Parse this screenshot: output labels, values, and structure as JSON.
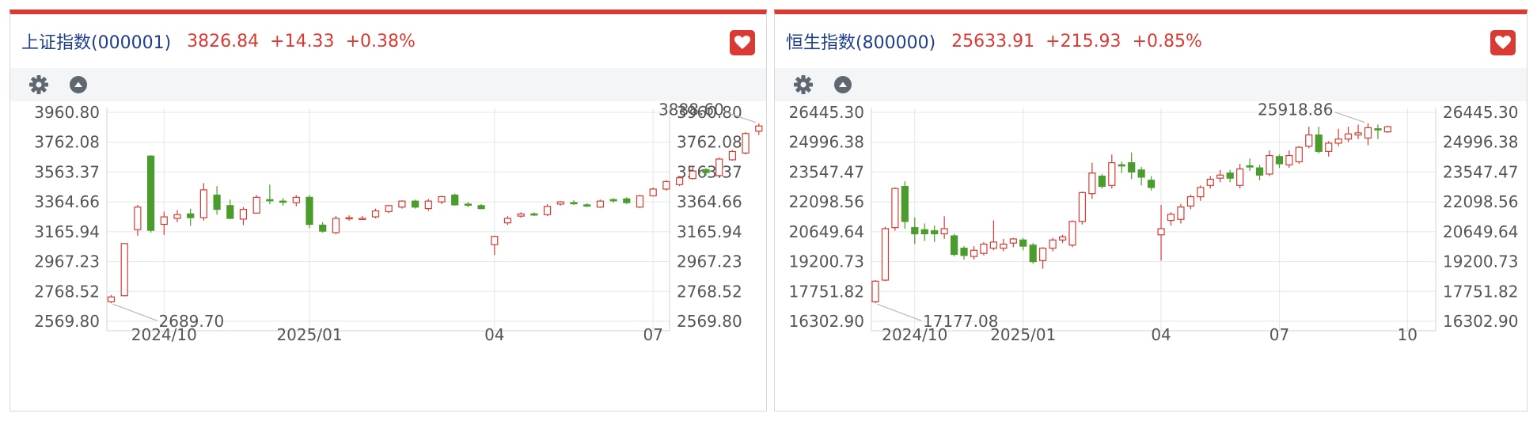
{
  "colors": {
    "up": "#d93a33",
    "down": "#4a9c2c",
    "header_name": "#1f3f8c",
    "accent": "#d93a33",
    "grid": "#e4e6e8",
    "axis_text": "#555555"
  },
  "toolbar": {
    "icons": [
      "gear-icon",
      "collapse-up-icon"
    ]
  },
  "panels": [
    {
      "name": "上证指数(000001)",
      "price": "3826.84",
      "change": "+14.33",
      "change_pct": "+0.38%",
      "favorite_icon": "heart-icon"
    },
    {
      "name": "恒生指数(800000)",
      "price": "25633.91",
      "change": "+215.93",
      "change_pct": "+0.85%",
      "favorite_icon": "heart-icon"
    }
  ],
  "chart_data": [
    {
      "type": "candlestick",
      "period": "weekly",
      "ylim": [
        2569.8,
        3960.8
      ],
      "y_ticks": [
        "3960.80",
        "3762.08",
        "3563.37",
        "3364.66",
        "3165.94",
        "2967.23",
        "2768.52",
        "2569.80"
      ],
      "x_tick_labels": [
        "2024/10",
        "2025/01",
        "04",
        "07"
      ],
      "max_annotation": "3888.60",
      "min_annotation": "2689.70",
      "candles": [
        {
          "o": 2700,
          "c": 2732,
          "h": 2745,
          "l": 2689.7
        },
        {
          "o": 2740,
          "c": 3087,
          "h": 3087,
          "l": 2736
        },
        {
          "o": 3180,
          "c": 3330,
          "h": 3345,
          "l": 3140
        },
        {
          "o": 3670,
          "c": 3175,
          "h": 3675,
          "l": 3160
        },
        {
          "o": 3215,
          "c": 3265,
          "h": 3300,
          "l": 3145
        },
        {
          "o": 3255,
          "c": 3280,
          "h": 3310,
          "l": 3230
        },
        {
          "o": 3285,
          "c": 3260,
          "h": 3320,
          "l": 3205
        },
        {
          "o": 3260,
          "c": 3445,
          "h": 3490,
          "l": 3240
        },
        {
          "o": 3410,
          "c": 3315,
          "h": 3470,
          "l": 3280
        },
        {
          "o": 3340,
          "c": 3255,
          "h": 3380,
          "l": 3250
        },
        {
          "o": 3250,
          "c": 3315,
          "h": 3330,
          "l": 3210
        },
        {
          "o": 3290,
          "c": 3395,
          "h": 3410,
          "l": 3290
        },
        {
          "o": 3380,
          "c": 3375,
          "h": 3480,
          "l": 3350
        },
        {
          "o": 3370,
          "c": 3365,
          "h": 3390,
          "l": 3340
        },
        {
          "o": 3360,
          "c": 3395,
          "h": 3410,
          "l": 3335
        },
        {
          "o": 3395,
          "c": 3215,
          "h": 3410,
          "l": 3190
        },
        {
          "o": 3210,
          "c": 3170,
          "h": 3230,
          "l": 3160
        },
        {
          "o": 3160,
          "c": 3255,
          "h": 3270,
          "l": 3150
        },
        {
          "o": 3255,
          "c": 3260,
          "h": 3275,
          "l": 3240
        },
        {
          "o": 3255,
          "c": 3255,
          "h": 3270,
          "l": 3245
        },
        {
          "o": 3265,
          "c": 3305,
          "h": 3320,
          "l": 3255
        },
        {
          "o": 3300,
          "c": 3340,
          "h": 3345,
          "l": 3290
        },
        {
          "o": 3330,
          "c": 3370,
          "h": 3375,
          "l": 3320
        },
        {
          "o": 3370,
          "c": 3330,
          "h": 3380,
          "l": 3320
        },
        {
          "o": 3320,
          "c": 3370,
          "h": 3385,
          "l": 3305
        },
        {
          "o": 3365,
          "c": 3400,
          "h": 3405,
          "l": 3350
        },
        {
          "o": 3410,
          "c": 3345,
          "h": 3420,
          "l": 3340
        },
        {
          "o": 3350,
          "c": 3345,
          "h": 3365,
          "l": 3330
        },
        {
          "o": 3340,
          "c": 3320,
          "h": 3350,
          "l": 3315
        },
        {
          "o": 3080,
          "c": 3135,
          "h": 3140,
          "l": 3012
        },
        {
          "o": 3225,
          "c": 3255,
          "h": 3270,
          "l": 3210
        },
        {
          "o": 3270,
          "c": 3285,
          "h": 3295,
          "l": 3260
        },
        {
          "o": 3285,
          "c": 3280,
          "h": 3295,
          "l": 3270
        },
        {
          "o": 3280,
          "c": 3335,
          "h": 3350,
          "l": 3270
        },
        {
          "o": 3350,
          "c": 3365,
          "h": 3370,
          "l": 3340
        },
        {
          "o": 3360,
          "c": 3355,
          "h": 3375,
          "l": 3345
        },
        {
          "o": 3345,
          "c": 3340,
          "h": 3355,
          "l": 3330
        },
        {
          "o": 3330,
          "c": 3370,
          "h": 3380,
          "l": 3325
        },
        {
          "o": 3380,
          "c": 3375,
          "h": 3390,
          "l": 3360
        },
        {
          "o": 3385,
          "c": 3360,
          "h": 3395,
          "l": 3350
        },
        {
          "o": 3330,
          "c": 3405,
          "h": 3410,
          "l": 3325
        },
        {
          "o": 3405,
          "c": 3450,
          "h": 3460,
          "l": 3400
        },
        {
          "o": 3450,
          "c": 3500,
          "h": 3510,
          "l": 3440
        },
        {
          "o": 3480,
          "c": 3525,
          "h": 3535,
          "l": 3470
        },
        {
          "o": 3520,
          "c": 3570,
          "h": 3595,
          "l": 3515
        },
        {
          "o": 3580,
          "c": 3560,
          "h": 3590,
          "l": 3540
        },
        {
          "o": 3540,
          "c": 3650,
          "h": 3660,
          "l": 3530
        },
        {
          "o": 3645,
          "c": 3700,
          "h": 3710,
          "l": 3640
        },
        {
          "o": 3690,
          "c": 3820,
          "h": 3830,
          "l": 3680
        },
        {
          "o": 3835,
          "c": 3870,
          "h": 3888.6,
          "l": 3810
        },
        {
          "o": 3870,
          "c": 3815,
          "h": 3880,
          "l": 3720
        },
        {
          "o": 3815,
          "c": 3830,
          "h": 3845,
          "l": 3808
        }
      ],
      "x_ticks": [
        {
          "label": "2024/10",
          "index": 4
        },
        {
          "label": "2025/01",
          "index": 15
        },
        {
          "label": "04",
          "index": 29
        },
        {
          "label": "07",
          "index": 41
        }
      ]
    },
    {
      "type": "candlestick",
      "period": "weekly",
      "ylim": [
        16302.9,
        26445.3
      ],
      "y_ticks": [
        "26445.30",
        "24996.38",
        "23547.47",
        "22098.56",
        "20649.64",
        "19200.73",
        "17751.82",
        "16302.90"
      ],
      "x_tick_labels": [
        "2024/10",
        "2025/01",
        "04",
        "07",
        "10"
      ],
      "max_annotation": "25918.86",
      "min_annotation": "17177.08",
      "candles": [
        {
          "o": 17250,
          "c": 18250,
          "h": 18300,
          "l": 17177.08
        },
        {
          "o": 18300,
          "c": 20800,
          "h": 20900,
          "l": 18250
        },
        {
          "o": 20850,
          "c": 22750,
          "h": 22800,
          "l": 20700
        },
        {
          "o": 22850,
          "c": 21150,
          "h": 23100,
          "l": 20800
        },
        {
          "o": 20850,
          "c": 20550,
          "h": 21350,
          "l": 20050
        },
        {
          "o": 20750,
          "c": 20550,
          "h": 21050,
          "l": 20200
        },
        {
          "o": 20700,
          "c": 20550,
          "h": 20950,
          "l": 20150
        },
        {
          "o": 20550,
          "c": 20800,
          "h": 21400,
          "l": 20300
        },
        {
          "o": 20450,
          "c": 19550,
          "h": 20550,
          "l": 19450
        },
        {
          "o": 19850,
          "c": 19500,
          "h": 19950,
          "l": 19300
        },
        {
          "o": 19450,
          "c": 19750,
          "h": 19950,
          "l": 19300
        },
        {
          "o": 19600,
          "c": 20050,
          "h": 20150,
          "l": 19500
        },
        {
          "o": 19850,
          "c": 20150,
          "h": 21200,
          "l": 19750
        },
        {
          "o": 19850,
          "c": 20050,
          "h": 20300,
          "l": 19700
        },
        {
          "o": 20100,
          "c": 20300,
          "h": 20350,
          "l": 19900
        },
        {
          "o": 20250,
          "c": 19950,
          "h": 20350,
          "l": 19750
        },
        {
          "o": 20000,
          "c": 19200,
          "h": 20100,
          "l": 19100
        },
        {
          "o": 19250,
          "c": 19850,
          "h": 19900,
          "l": 18850
        },
        {
          "o": 19850,
          "c": 20250,
          "h": 20350,
          "l": 19700
        },
        {
          "o": 20250,
          "c": 20400,
          "h": 20500,
          "l": 20100
        },
        {
          "o": 20000,
          "c": 21150,
          "h": 21200,
          "l": 19900
        },
        {
          "o": 21150,
          "c": 22550,
          "h": 22600,
          "l": 21000
        },
        {
          "o": 22500,
          "c": 23500,
          "h": 24000,
          "l": 22250
        },
        {
          "o": 23350,
          "c": 22850,
          "h": 23450,
          "l": 22750
        },
        {
          "o": 22900,
          "c": 24000,
          "h": 24400,
          "l": 22750
        },
        {
          "o": 23900,
          "c": 23850,
          "h": 24050,
          "l": 23500
        },
        {
          "o": 24000,
          "c": 23550,
          "h": 24500,
          "l": 23200
        },
        {
          "o": 23650,
          "c": 23300,
          "h": 23800,
          "l": 22900
        },
        {
          "o": 23150,
          "c": 22800,
          "h": 23350,
          "l": 22650
        },
        {
          "o": 20500,
          "c": 20800,
          "h": 21950,
          "l": 19250
        },
        {
          "o": 21200,
          "c": 21500,
          "h": 21600,
          "l": 20950
        },
        {
          "o": 21250,
          "c": 21850,
          "h": 22000,
          "l": 21050
        },
        {
          "o": 21900,
          "c": 22350,
          "h": 22450,
          "l": 21750
        },
        {
          "o": 22350,
          "c": 22800,
          "h": 22900,
          "l": 22150
        },
        {
          "o": 22900,
          "c": 23200,
          "h": 23350,
          "l": 22750
        },
        {
          "o": 23250,
          "c": 23400,
          "h": 23650,
          "l": 23050
        },
        {
          "o": 23500,
          "c": 23250,
          "h": 23650,
          "l": 23050
        },
        {
          "o": 22900,
          "c": 23700,
          "h": 23950,
          "l": 22750
        },
        {
          "o": 23850,
          "c": 23800,
          "h": 24200,
          "l": 23600
        },
        {
          "o": 23750,
          "c": 23400,
          "h": 23900,
          "l": 23150
        },
        {
          "o": 23450,
          "c": 24350,
          "h": 24600,
          "l": 23350
        },
        {
          "o": 24300,
          "c": 23950,
          "h": 24400,
          "l": 23750
        },
        {
          "o": 23900,
          "c": 24350,
          "h": 24600,
          "l": 23750
        },
        {
          "o": 24050,
          "c": 24750,
          "h": 24800,
          "l": 23950
        },
        {
          "o": 24800,
          "c": 25350,
          "h": 25750,
          "l": 24700
        },
        {
          "o": 25350,
          "c": 24550,
          "h": 25750,
          "l": 24450
        },
        {
          "o": 24550,
          "c": 24950,
          "h": 25050,
          "l": 24300
        },
        {
          "o": 24950,
          "c": 25150,
          "h": 25650,
          "l": 24800
        },
        {
          "o": 25150,
          "c": 25400,
          "h": 25750,
          "l": 25000
        },
        {
          "o": 25350,
          "c": 25450,
          "h": 25850,
          "l": 25150
        },
        {
          "o": 25200,
          "c": 25700,
          "h": 25918.86,
          "l": 24850
        },
        {
          "o": 25650,
          "c": 25600,
          "h": 25850,
          "l": 25150
        },
        {
          "o": 25500,
          "c": 25750,
          "h": 25800,
          "l": 25450
        }
      ],
      "x_ticks": [
        {
          "label": "2024/10",
          "index": 4
        },
        {
          "label": "2025/01",
          "index": 15
        },
        {
          "label": "04",
          "index": 29
        },
        {
          "label": "07",
          "index": 41
        },
        {
          "label": "10",
          "index": 54
        }
      ]
    }
  ]
}
